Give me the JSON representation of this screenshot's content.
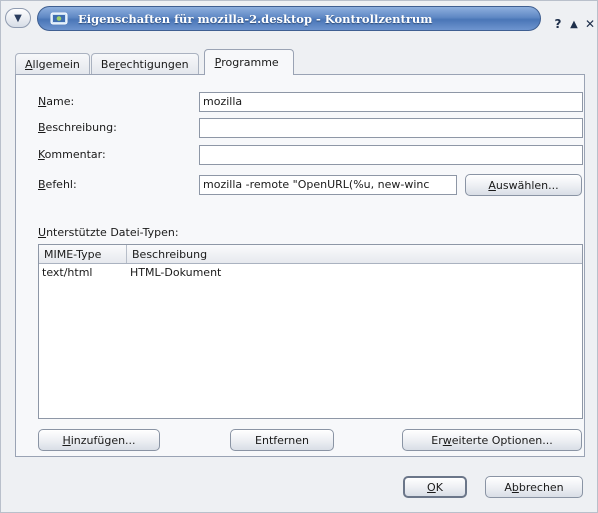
{
  "window": {
    "title": "Eigenschaften für mozilla-2.desktop - Kontrollzentrum",
    "help_label": "?",
    "maximize_label": "▲",
    "close_label": "✕"
  },
  "tabs": [
    {
      "label": "Allgemein",
      "mnemonic": "A",
      "rest": "llgemein"
    },
    {
      "label": "Berechtigungen",
      "pre": "Be",
      "mnemonic": "r",
      "rest": "echtigungen"
    },
    {
      "label": "Programme",
      "mnemonic": "P",
      "rest": "rogramme",
      "active": true
    }
  ],
  "form": {
    "name": {
      "mnemonic": "N",
      "rest": "ame:",
      "value": "mozilla"
    },
    "description": {
      "mnemonic": "B",
      "rest": "eschreibung:",
      "value": ""
    },
    "comment": {
      "mnemonic": "K",
      "rest": "ommentar:",
      "value": ""
    },
    "command": {
      "mnemonic": "B",
      "rest": "efehl:",
      "value": "mozilla -remote \"OpenURL(%u, new-winc"
    },
    "choose_button": {
      "mnemonic": "A",
      "rest": "uswählen..."
    }
  },
  "file_types": {
    "label_mnemonic": "U",
    "label_rest": "nterstützte Datei-Typen:",
    "columns": [
      "MIME-Type",
      "Beschreibung"
    ],
    "rows": [
      {
        "mime": "text/html",
        "description": "HTML-Dokument"
      }
    ]
  },
  "actions": {
    "add": {
      "mnemonic": "H",
      "rest": "inzufügen..."
    },
    "remove": {
      "label": "Entfernen"
    },
    "advanced": {
      "pre": "Er",
      "mnemonic": "w",
      "rest": "eiterte Optionen..."
    }
  },
  "dialog_buttons": {
    "ok": {
      "mnemonic": "O",
      "rest": "K"
    },
    "cancel": {
      "pre": "A",
      "mnemonic": "b",
      "rest": "brechen"
    }
  },
  "colors": {
    "titlebar_accent": "#5f88c4",
    "window_bg": "#eef0f3"
  }
}
